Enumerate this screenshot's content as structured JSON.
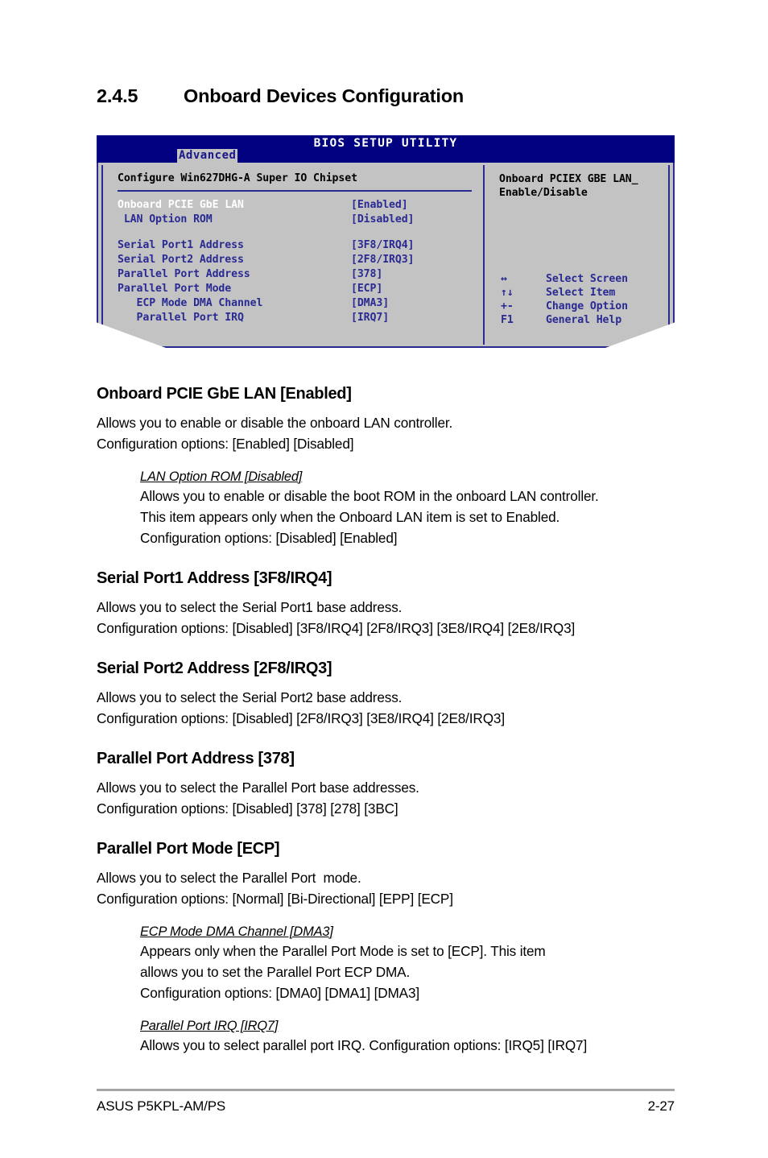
{
  "section": {
    "number": "2.4.5",
    "title": "Onboard Devices Configuration"
  },
  "bios_screen": {
    "title": "BIOS SETUP UTILITY",
    "active_tab": "Advanced",
    "config_heading": "Configure Win627DHG-A Super IO Chipset",
    "items": [
      {
        "label": "Onboard PCIE GbE LAN",
        "value": "[Enabled]",
        "selected": true,
        "gap_after": false
      },
      {
        "label": " LAN Option ROM",
        "value": "[Disabled]",
        "selected": false,
        "gap_after": true
      },
      {
        "label": "Serial Port1 Address",
        "value": "[3F8/IRQ4]",
        "selected": false,
        "gap_after": false
      },
      {
        "label": "Serial Port2 Address",
        "value": "[2F8/IRQ3]",
        "selected": false,
        "gap_after": false
      },
      {
        "label": "Parallel Port Address",
        "value": "[378]",
        "selected": false,
        "gap_after": false
      },
      {
        "label": "Parallel Port Mode",
        "value": "[ECP]",
        "selected": false,
        "gap_after": false
      },
      {
        "label": "   ECP Mode DMA Channel",
        "value": "[DMA3]",
        "selected": false,
        "gap_after": false
      },
      {
        "label": "   Parallel Port IRQ",
        "value": "[IRQ7]",
        "selected": false,
        "gap_after": false
      }
    ],
    "help": "Onboard PCIEX GBE LAN_\nEnable/Disable",
    "legend": [
      {
        "key": "↔",
        "action": "Select Screen"
      },
      {
        "key": "↑↓",
        "action": "Select Item"
      },
      {
        "key": "+-",
        "action": "Change Option"
      },
      {
        "key": "F1",
        "action": "General Help"
      }
    ],
    "colors": {
      "titlebar": "#000080",
      "panel": "#c3c3c3",
      "border": "#2a2a93",
      "text_blue": "#2a2a93",
      "text_selected": "#ffffff"
    }
  },
  "sections": [
    {
      "heading": "Onboard PCIE GbE LAN [Enabled]",
      "lines": [
        "Allows you to enable or disable the onboard LAN controller.",
        "Configuration options: [Enabled] [Disabled]"
      ],
      "sub": [
        {
          "heading": "LAN Option ROM [Disabled]",
          "lines": [
            "Allows you to enable or disable the boot ROM in the onboard LAN controller.",
            "This item appears only when the Onboard LAN item is set to Enabled.",
            "Configuration options: [Disabled] [Enabled]"
          ]
        }
      ]
    },
    {
      "heading": "Serial Port1 Address [3F8/IRQ4]",
      "lines": [
        "Allows you to select the Serial Port1 base address.",
        "Configuration options: [Disabled] [3F8/IRQ4] [2F8/IRQ3] [3E8/IRQ4] [2E8/IRQ3]"
      ],
      "sub": []
    },
    {
      "heading": "Serial Port2 Address [2F8/IRQ3]",
      "lines": [
        "Allows you to select the Serial Port2 base address.",
        "Configuration options: [Disabled] [2F8/IRQ3] [3E8/IRQ4] [2E8/IRQ3]"
      ],
      "sub": []
    },
    {
      "heading": "Parallel Port Address [378]",
      "lines": [
        "Allows you to select the Parallel Port base addresses.",
        "Configuration options: [Disabled] [378] [278] [3BC]"
      ],
      "sub": []
    },
    {
      "heading": "Parallel Port Mode [ECP]",
      "lines": [
        "Allows you to select the Parallel Port  mode.",
        "Configuration options: [Normal] [Bi-Directional] [EPP] [ECP]"
      ],
      "sub": [
        {
          "heading": "ECP Mode DMA Channel [DMA3]",
          "lines": [
            "Appears only when the Parallel Port Mode is set to [ECP]. This item",
            "allows you to set the Parallel Port ECP DMA.",
            "Configuration options: [DMA0] [DMA1] [DMA3]"
          ]
        },
        {
          "heading": "Parallel Port IRQ [IRQ7]",
          "lines": [
            "Allows you to select parallel port IRQ. Configuration options: [IRQ5] [IRQ7]"
          ]
        }
      ]
    }
  ],
  "footer": {
    "left": "ASUS P5KPL-AM/PS",
    "right": "2-27"
  }
}
